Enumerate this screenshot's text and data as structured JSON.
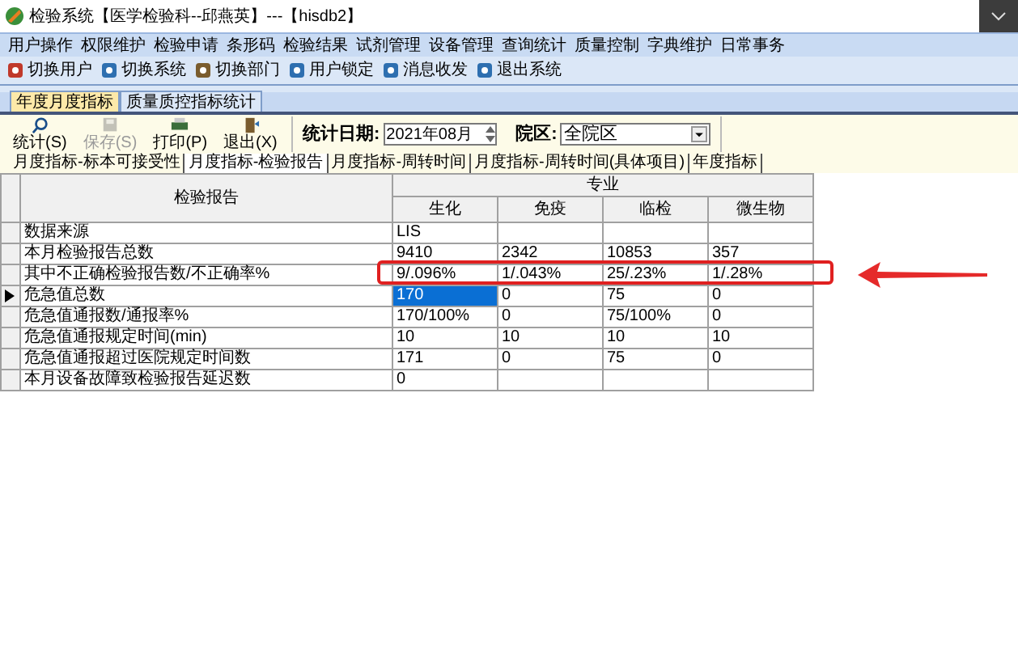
{
  "window": {
    "title": "检验系统【医学检验科--邱燕英】---【hisdb2】"
  },
  "menu": [
    "用户操作",
    "权限维护",
    "检验申请",
    "条形码",
    "检验结果",
    "试剂管理",
    "设备管理",
    "查询统计",
    "质量控制",
    "字典维护",
    "日常事务"
  ],
  "toolbar": [
    "切换用户",
    "切换系统",
    "切换部门",
    "用户锁定",
    "消息收发",
    "退出系统"
  ],
  "tabs": [
    {
      "label": "年度月度指标",
      "selected": true
    },
    {
      "label": "质量质控指标统计",
      "selected": false
    }
  ],
  "actions": [
    {
      "label": "统计(S)",
      "disabled": false
    },
    {
      "label": "保存(S)",
      "disabled": true
    },
    {
      "label": "打印(P)",
      "disabled": false
    },
    {
      "label": "退出(X)",
      "disabled": false
    }
  ],
  "date": {
    "label": "统计日期:",
    "value": "2021年08月"
  },
  "campus": {
    "label": "院区:",
    "value": "全院区"
  },
  "subtabs": [
    {
      "label": "月度指标-标本可接受性",
      "selected": false
    },
    {
      "label": "月度指标-检验报告",
      "selected": true
    },
    {
      "label": "月度指标-周转时间",
      "selected": false
    },
    {
      "label": "月度指标-周转时间(具体项目)",
      "selected": false
    },
    {
      "label": "年度指标",
      "selected": false
    }
  ],
  "table": {
    "header": "检验报告",
    "group": "专业",
    "columns": [
      "生化",
      "免疫",
      "临检",
      "微生物"
    ],
    "rows": [
      {
        "label": "数据来源",
        "values": [
          "LIS"
        ],
        "current": false,
        "highlighted": false
      },
      {
        "label": "本月检验报告总数",
        "values": [
          "9410",
          "2342",
          "10853",
          "357"
        ],
        "current": false,
        "highlighted": false
      },
      {
        "label": "其中不正确检验报告数/不正确率%",
        "values": [
          "9/.096%",
          "1/.043%",
          "25/.23%",
          "1/.28%"
        ],
        "current": false,
        "highlighted": true
      },
      {
        "label": "危急值总数",
        "values": [
          "170",
          "0",
          "75",
          "0"
        ],
        "current": true,
        "highlighted": false
      },
      {
        "label": "危急值通报数/通报率%",
        "values": [
          "170/100%",
          "0",
          "75/100%",
          "0"
        ],
        "current": false,
        "highlighted": false
      },
      {
        "label": "危急值通报规定时间(min)",
        "values": [
          "10",
          "10",
          "10",
          "10"
        ],
        "current": false,
        "highlighted": false
      },
      {
        "label": "危急值通报超过医院规定时间数",
        "values": [
          "171",
          "0",
          "75",
          "0"
        ],
        "current": false,
        "highlighted": false
      },
      {
        "label": "本月设备故障致检验报告延迟数",
        "values": [
          "0"
        ],
        "current": false,
        "highlighted": false
      }
    ]
  }
}
